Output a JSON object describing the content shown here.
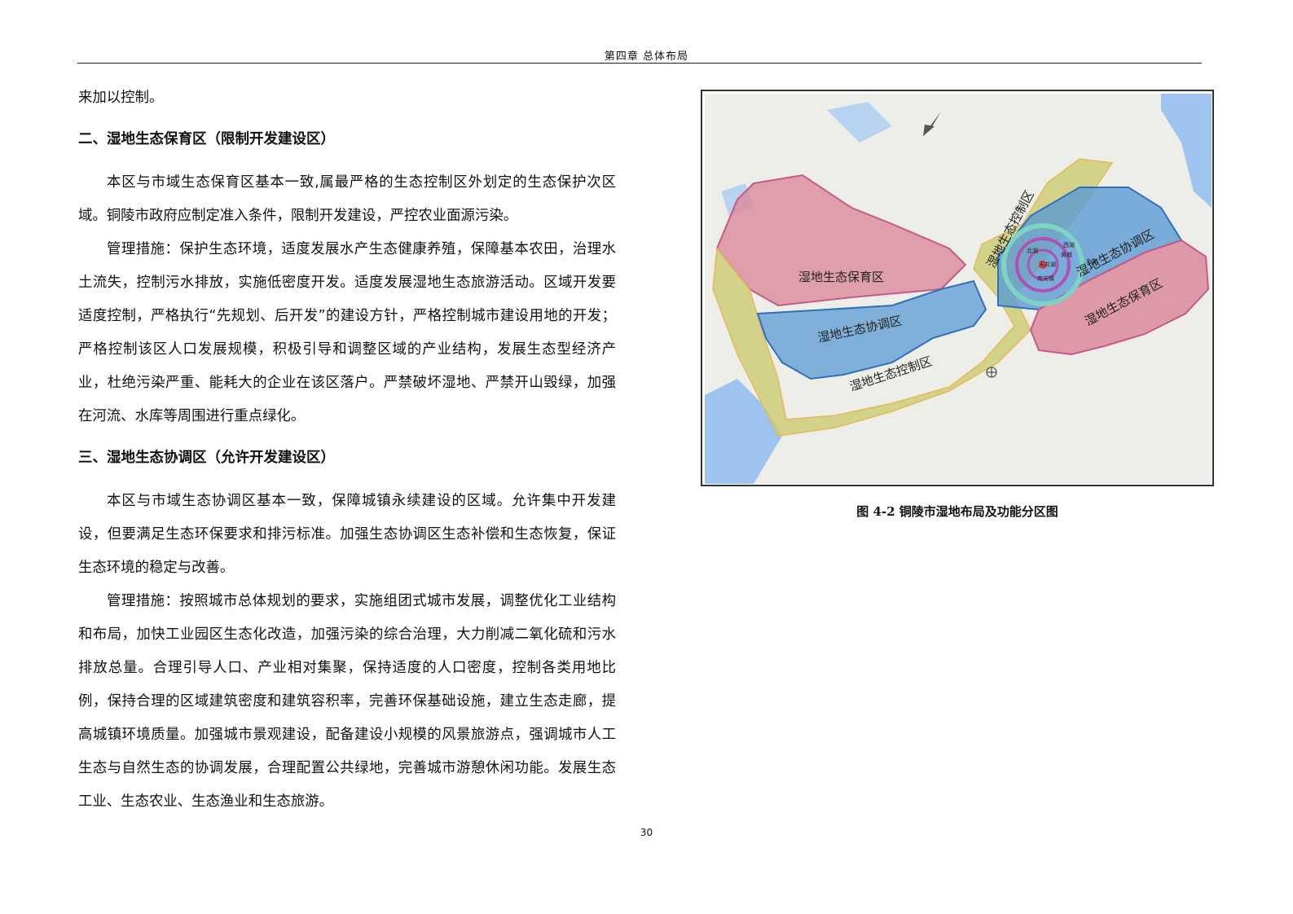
{
  "header": {
    "chapter_title": "第四章  总体布局"
  },
  "text": {
    "intro_line": "来加以控制。",
    "section2_heading": "二、湿地生态保育区（限制开发建设区）",
    "section2_para1": "本区与市域生态保育区基本一致,属最严格的生态控制区外划定的生态保护次区域。铜陵市政府应制定准入条件，限制开发建设，严控农业面源污染。",
    "section2_para2": "管理措施：保护生态环境，适度发展水产生态健康养殖，保障基本农田，治理水土流失，控制污水排放，实施低密度开发。适度发展湿地生态旅游活动。区域开发要适度控制，严格执行“先规划、后开发”的建设方针，严格控制城市建设用地的开发；严格控制该区人口发展规模，积极引导和调整区域的产业结构，发展生态型经济产业，杜绝污染严重、能耗大的企业在该区落户。严禁破坏湿地、严禁开山毁绿，加强在河流、水库等周围进行重点绿化。",
    "section3_heading": "三、湿地生态协调区（允许开发建设区）",
    "section3_para1": "本区与市域生态协调区基本一致，保障城镇永续建设的区域。允许集中开发建设，但要满足生态环保要求和排污标准。加强生态协调区生态补偿和生态恢复，保证生态环境的稳定与改善。",
    "section3_para2": "管理措施：按照城市总体规划的要求，实施组团式城市发展，调整优化工业结构和布局，加快工业园区生态化改造，加强污染的综合治理，大力削减二氧化硫和污水排放总量。合理引导人口、产业相对集聚，保持适度的人口密度，控制各类用地比例，保持合理的区域建筑密度和建筑容积率，完善环保基础设施，建立生态走廊，提高城镇环境质量。加强城市景观建设，配备建设小规模的风景旅游点，强调城市人工生态与自然生态的协调发展，合理配置公共绿地，完善城市游憩休闲功能。发展生态工业、生态农业、生态渔业和生态旅游。"
  },
  "map": {
    "labels": {
      "protect_west": "湿地生态保育区",
      "coord_west": "湿地生态协调区",
      "control_south": "湿地生态控制区",
      "control_north": "湿地生态控制区",
      "coord_east": "湿地生态协调区",
      "protect_east": "湿地生态保育区"
    },
    "lake_labels": {
      "north_lake": "北湖",
      "west_lake": "西湖",
      "east_lake": "东湖",
      "tianjing_lake": "天井湖",
      "center": "黄城",
      "south": "南安镇"
    },
    "colors": {
      "protect": "#d98a9a",
      "coordinate": "#5b9bd5",
      "control": "#c8c86a",
      "water": "#9ec3ee",
      "base": "#efefe9"
    },
    "icons": [
      "north-arrow-icon",
      "compass-icon"
    ]
  },
  "figure": {
    "caption": "图 4-2  铜陵市湿地布局及功能分区图"
  },
  "footer": {
    "page_number": "30"
  }
}
